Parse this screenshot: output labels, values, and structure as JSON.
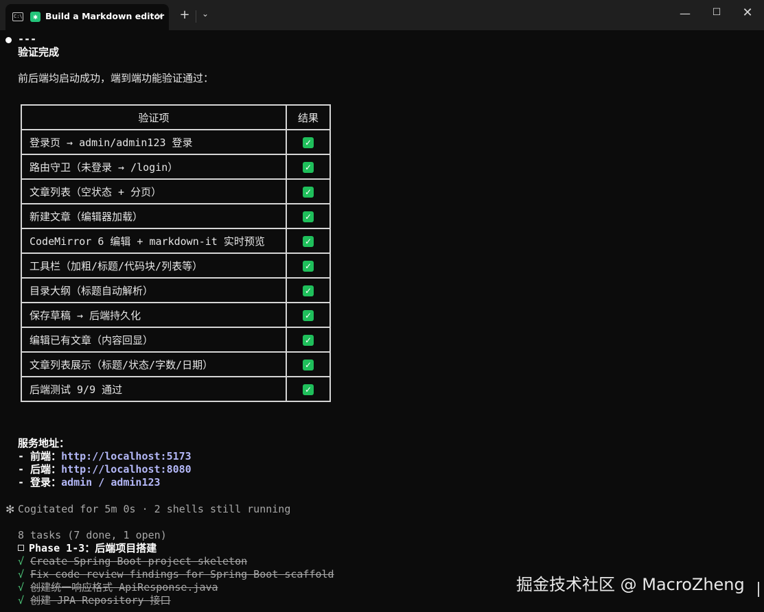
{
  "window": {
    "tab_title": "Build a Markdown editor",
    "shell_icon_text": "C:\\",
    "app_icon": "asterisk-icon",
    "tab_close": "✕",
    "new_tab": "+",
    "tab_dropdown": "⌄",
    "minimize": "—",
    "maximize": "☐",
    "close": "✕"
  },
  "terminal": {
    "rule": "---",
    "heading": "验证完成",
    "intro": "前后端均启动成功，端到端功能验证通过：",
    "table": {
      "headers": [
        "验证项",
        "结果"
      ],
      "rows": [
        {
          "item": "登录页 → admin/admin123 登录",
          "result": "✓"
        },
        {
          "item": "路由守卫（未登录 → /login）",
          "result": "✓"
        },
        {
          "item": "文章列表（空状态 + 分页）",
          "result": "✓"
        },
        {
          "item": "新建文章（编辑器加载）",
          "result": "✓"
        },
        {
          "item": "CodeMirror 6 编辑 + markdown-it 实时预览",
          "result": "✓"
        },
        {
          "item": "工具栏（加粗/标题/代码块/列表等）",
          "result": "✓"
        },
        {
          "item": "目录大纲（标题自动解析）",
          "result": "✓"
        },
        {
          "item": "保存草稿 → 后端持久化",
          "result": "✓"
        },
        {
          "item": "编辑已有文章（内容回显）",
          "result": "✓"
        },
        {
          "item": "文章列表展示（标题/状态/字数/日期）",
          "result": "✓"
        },
        {
          "item": "后端测试 9/9 通过",
          "result": "✓"
        }
      ]
    },
    "services": {
      "title": "服务地址：",
      "frontend_label": "- 前端：",
      "frontend_url": "http://localhost:5173",
      "backend_label": "- 后端：",
      "backend_url": "http://localhost:8080",
      "login_label": "- 登录：",
      "login_user": "admin",
      "login_sep": " / ",
      "login_pass": "admin123"
    },
    "status": {
      "spinner": "✻",
      "text": "Cogitated for 5m 0s · 2 shells still running"
    },
    "tasks": {
      "summary": "8 tasks (7 done, 1 open)",
      "open_item": "Phase 1-3：后端项目搭建",
      "done_mark": "√",
      "done_items": [
        "Create Spring Boot project skeleton",
        "Fix code review findings for Spring Boot scaffold",
        "创建统一响应格式 ApiResponse.java",
        "创建 JPA Repository 接口"
      ]
    }
  },
  "watermark": "掘金技术社区 @ MacroZheng",
  "colors": {
    "background": "#0c0c0c",
    "titlebar": "#1f1f1f",
    "link": "#b4b8f8",
    "check": "#1fbf5b"
  }
}
